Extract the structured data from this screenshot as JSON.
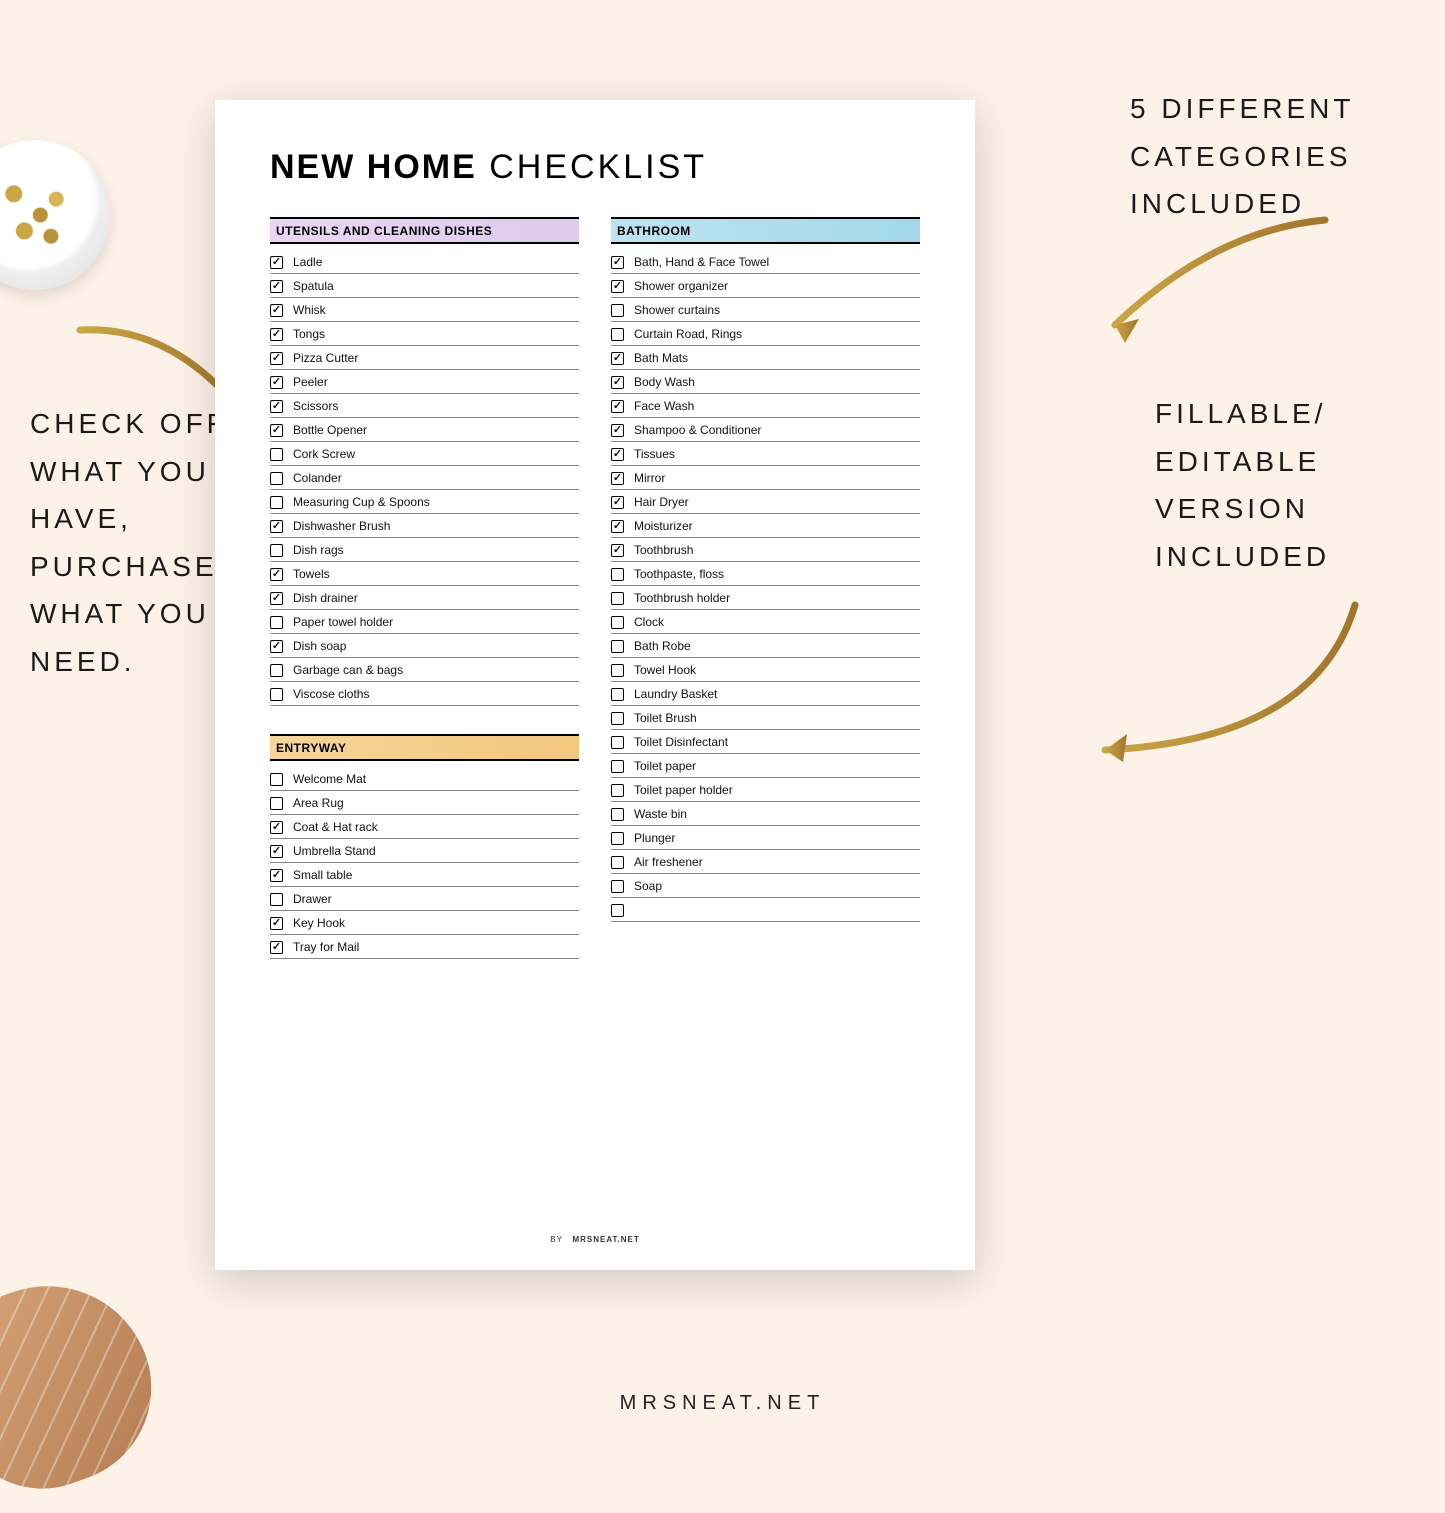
{
  "document": {
    "title_bold": "NEW HOME",
    "title_light": "CHECKLIST",
    "footer_by": "BY",
    "footer_brand": "MRSNEAT.NET"
  },
  "callouts": {
    "left": "CHECK OFF WHAT YOU HAVE, PURCHASE WHAT YOU NEED.",
    "top_right": "5 DIFFERENT CATEGORIES INCLUDED",
    "right": "FILLABLE/ EDITABLE VERSION INCLUDED"
  },
  "site_footer": "MRSNEAT.NET",
  "sections": {
    "utensils": {
      "heading": "UTENSILS AND CLEANING DISHES",
      "color": "purple",
      "items": [
        {
          "label": "Ladle",
          "checked": true
        },
        {
          "label": "Spatula",
          "checked": true
        },
        {
          "label": "Whisk",
          "checked": true
        },
        {
          "label": "Tongs",
          "checked": true
        },
        {
          "label": "Pizza Cutter",
          "checked": true
        },
        {
          "label": "Peeler",
          "checked": true
        },
        {
          "label": "Scissors",
          "checked": true
        },
        {
          "label": "Bottle Opener",
          "checked": true
        },
        {
          "label": "Cork Screw",
          "checked": false
        },
        {
          "label": "Colander",
          "checked": false
        },
        {
          "label": "Measuring Cup & Spoons",
          "checked": false
        },
        {
          "label": "Dishwasher Brush",
          "checked": true
        },
        {
          "label": "Dish rags",
          "checked": false
        },
        {
          "label": "Towels",
          "checked": true
        },
        {
          "label": "Dish drainer",
          "checked": true
        },
        {
          "label": "Paper towel holder",
          "checked": false
        },
        {
          "label": "Dish soap",
          "checked": true
        },
        {
          "label": "Garbage can & bags",
          "checked": false
        },
        {
          "label": "Viscose cloths",
          "checked": false
        }
      ]
    },
    "entryway": {
      "heading": "ENTRYWAY",
      "color": "orange",
      "items": [
        {
          "label": "Welcome Mat",
          "checked": false
        },
        {
          "label": "Area Rug",
          "checked": false
        },
        {
          "label": "Coat & Hat rack",
          "checked": true
        },
        {
          "label": "Umbrella Stand",
          "checked": true
        },
        {
          "label": "Small table",
          "checked": true
        },
        {
          "label": "Drawer",
          "checked": false
        },
        {
          "label": "Key Hook",
          "checked": true
        },
        {
          "label": "Tray for Mail",
          "checked": true
        }
      ]
    },
    "bathroom": {
      "heading": "BATHROOM",
      "color": "blue",
      "items": [
        {
          "label": "Bath, Hand & Face Towel",
          "checked": true
        },
        {
          "label": "Shower organizer",
          "checked": true
        },
        {
          "label": "Shower curtains",
          "checked": false
        },
        {
          "label": "Curtain Road, Rings",
          "checked": false
        },
        {
          "label": "Bath Mats",
          "checked": true
        },
        {
          "label": "Body Wash",
          "checked": true
        },
        {
          "label": "Face Wash",
          "checked": true
        },
        {
          "label": "Shampoo & Conditioner",
          "checked": true
        },
        {
          "label": "Tissues",
          "checked": true
        },
        {
          "label": "Mirror",
          "checked": true
        },
        {
          "label": "Hair Dryer",
          "checked": true
        },
        {
          "label": "Moisturizer",
          "checked": true
        },
        {
          "label": "Toothbrush",
          "checked": true
        },
        {
          "label": "Toothpaste, floss",
          "checked": false
        },
        {
          "label": "Toothbrush holder",
          "checked": false
        },
        {
          "label": "Clock",
          "checked": false
        },
        {
          "label": "Bath Robe",
          "checked": false
        },
        {
          "label": "Towel Hook",
          "checked": false
        },
        {
          "label": "Laundry Basket",
          "checked": false
        },
        {
          "label": "Toilet Brush",
          "checked": false
        },
        {
          "label": "Toilet Disinfectant",
          "checked": false
        },
        {
          "label": "Toilet paper",
          "checked": false
        },
        {
          "label": "Toilet paper holder",
          "checked": false
        },
        {
          "label": "Waste bin",
          "checked": false
        },
        {
          "label": "Plunger",
          "checked": false
        },
        {
          "label": "Air freshener",
          "checked": false
        },
        {
          "label": "Soap",
          "checked": false
        },
        {
          "label": "",
          "checked": false
        }
      ]
    }
  }
}
